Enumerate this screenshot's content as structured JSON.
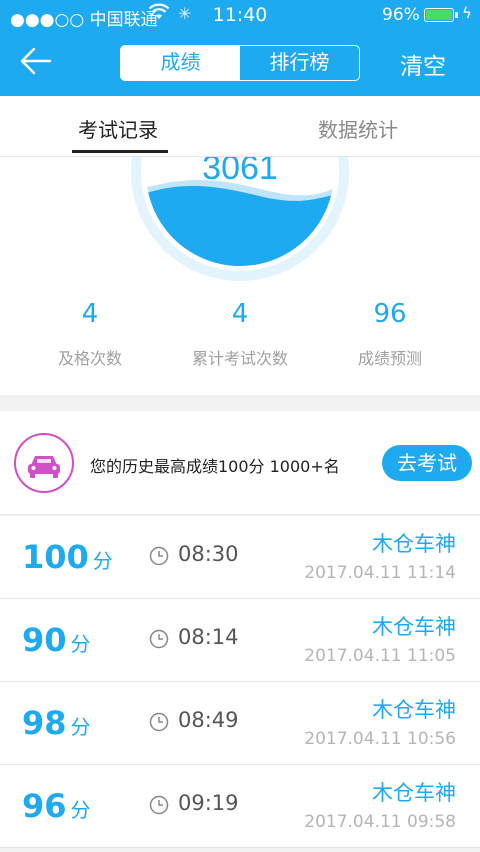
{
  "status_bar": {
    "carrier": "●●●○○ 中国联通",
    "time": "11:40",
    "battery": "96%"
  },
  "nav": {
    "segments": [
      "成绩",
      "排行榜"
    ],
    "clear": "清空"
  },
  "tabs": [
    "考试记录",
    "数据统计"
  ],
  "gauge": {
    "value": "3061"
  },
  "stats": [
    {
      "value": "4",
      "label": "及格次数"
    },
    {
      "value": "4",
      "label": "累计考试次数"
    },
    {
      "value": "96",
      "label": "成绩预测"
    }
  ],
  "best": {
    "text": "您的历史最高成绩100分  1000+名",
    "button": "去考试"
  },
  "records": [
    {
      "score": "100",
      "unit": "分",
      "duration": "08:30",
      "title": "木仓车神",
      "date": "2017.04.11 11:14"
    },
    {
      "score": "90",
      "unit": "分",
      "duration": "08:14",
      "title": "木仓车神",
      "date": "2017.04.11 11:05"
    },
    {
      "score": "98",
      "unit": "分",
      "duration": "08:49",
      "title": "木仓车神",
      "date": "2017.04.11 10:56"
    },
    {
      "score": "96",
      "unit": "分",
      "duration": "09:19",
      "title": "木仓车神",
      "date": "2017.04.11 09:58"
    }
  ],
  "icons": {
    "back": "back-arrow-icon",
    "wifi": "wifi-icon",
    "loading": "loading-icon",
    "battery": "battery-icon",
    "car": "car-icon",
    "clock": "clock-icon"
  },
  "colors": {
    "primary": "#1eaaf1",
    "battery_fill": "#4cd964",
    "car_icon": "#d24fc6"
  }
}
